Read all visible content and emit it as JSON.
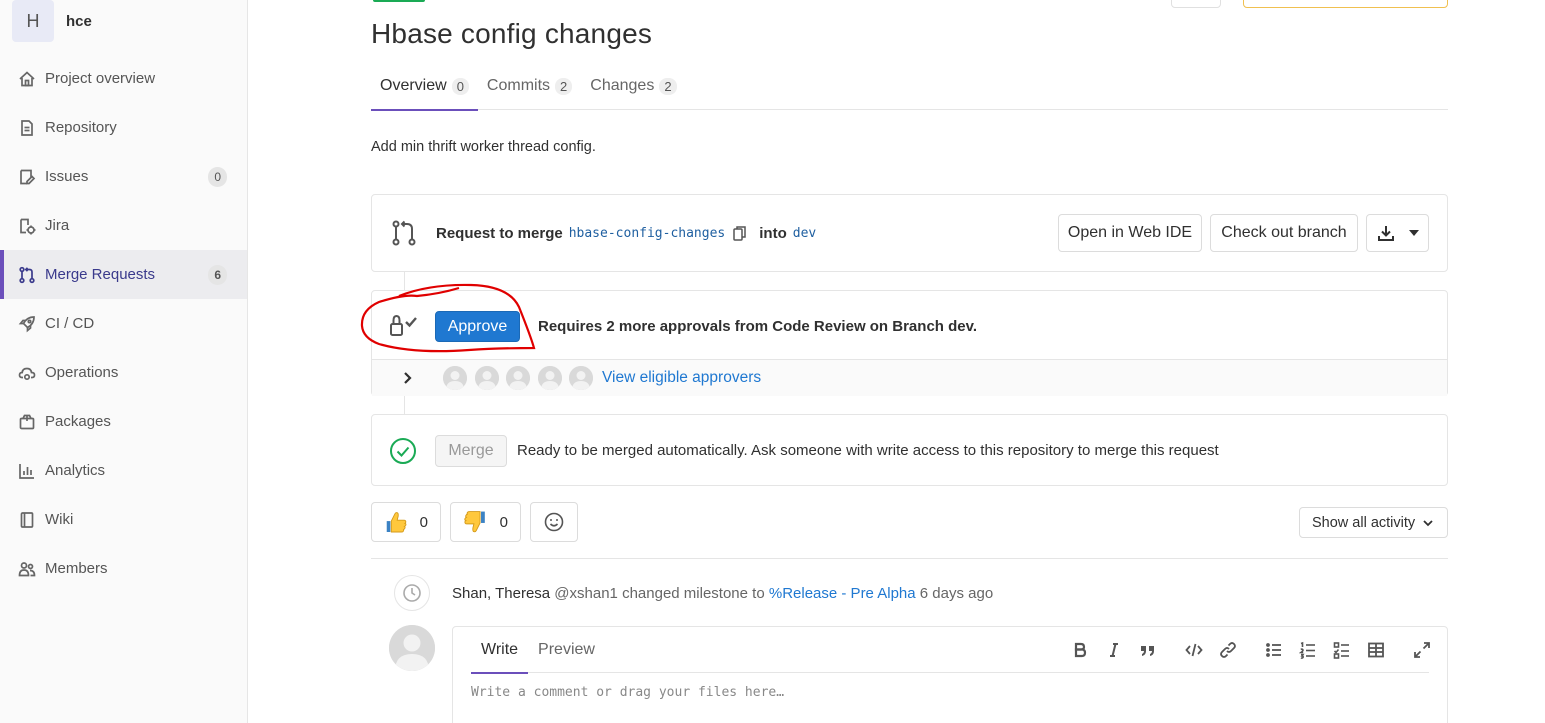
{
  "sidebar": {
    "project_letter": "H",
    "project_name": "hce",
    "items": [
      {
        "label": "Project overview",
        "icon": "home-icon"
      },
      {
        "label": "Repository",
        "icon": "document-icon"
      },
      {
        "label": "Issues",
        "icon": "issues-icon",
        "count": "0"
      },
      {
        "label": "Jira",
        "icon": "jira-icon"
      },
      {
        "label": "Merge Requests",
        "icon": "merge-request-icon",
        "count": "6",
        "active": true
      },
      {
        "label": "CI / CD",
        "icon": "rocket-icon"
      },
      {
        "label": "Operations",
        "icon": "cloud-gear-icon"
      },
      {
        "label": "Packages",
        "icon": "package-icon"
      },
      {
        "label": "Analytics",
        "icon": "chart-icon"
      },
      {
        "label": "Wiki",
        "icon": "book-icon"
      },
      {
        "label": "Members",
        "icon": "users-icon"
      }
    ]
  },
  "mr": {
    "title": "Hbase config changes",
    "tabs": [
      {
        "label": "Overview",
        "count": "0"
      },
      {
        "label": "Commits",
        "count": "2"
      },
      {
        "label": "Changes",
        "count": "2"
      }
    ],
    "description": "Add min thrift worker thread config.",
    "request_prefix": "Request to merge",
    "source_branch": "hbase-config-changes",
    "into_label": "into",
    "target_branch": "dev",
    "open_web_ide": "Open in Web IDE",
    "check_out_branch": "Check out branch"
  },
  "approval": {
    "approve_label": "Approve",
    "requirement_text": "Requires 2 more approvals from Code Review on Branch dev.",
    "view_approvers": "View eligible approvers"
  },
  "merge": {
    "merge_label": "Merge",
    "status_text": "Ready to be merged automatically. Ask someone with write access to this repository to merge this request"
  },
  "awards": {
    "thumbs_up": "0",
    "thumbs_down": "0"
  },
  "activity_filter": "Show all activity",
  "system_note": {
    "author": "Shan, Theresa",
    "handle": "@xshan1",
    "action": "changed milestone to",
    "milestone": "%Release - Pre Alpha",
    "time": "6 days ago"
  },
  "comment": {
    "write_tab": "Write",
    "preview_tab": "Preview",
    "placeholder": "Write a comment or drag your files here…"
  },
  "colors": {
    "accent": "#6b4fbb",
    "primary_button": "#1f78d1",
    "link": "#1f78d1",
    "success": "#1aaa55",
    "annotation": "#e00000"
  }
}
